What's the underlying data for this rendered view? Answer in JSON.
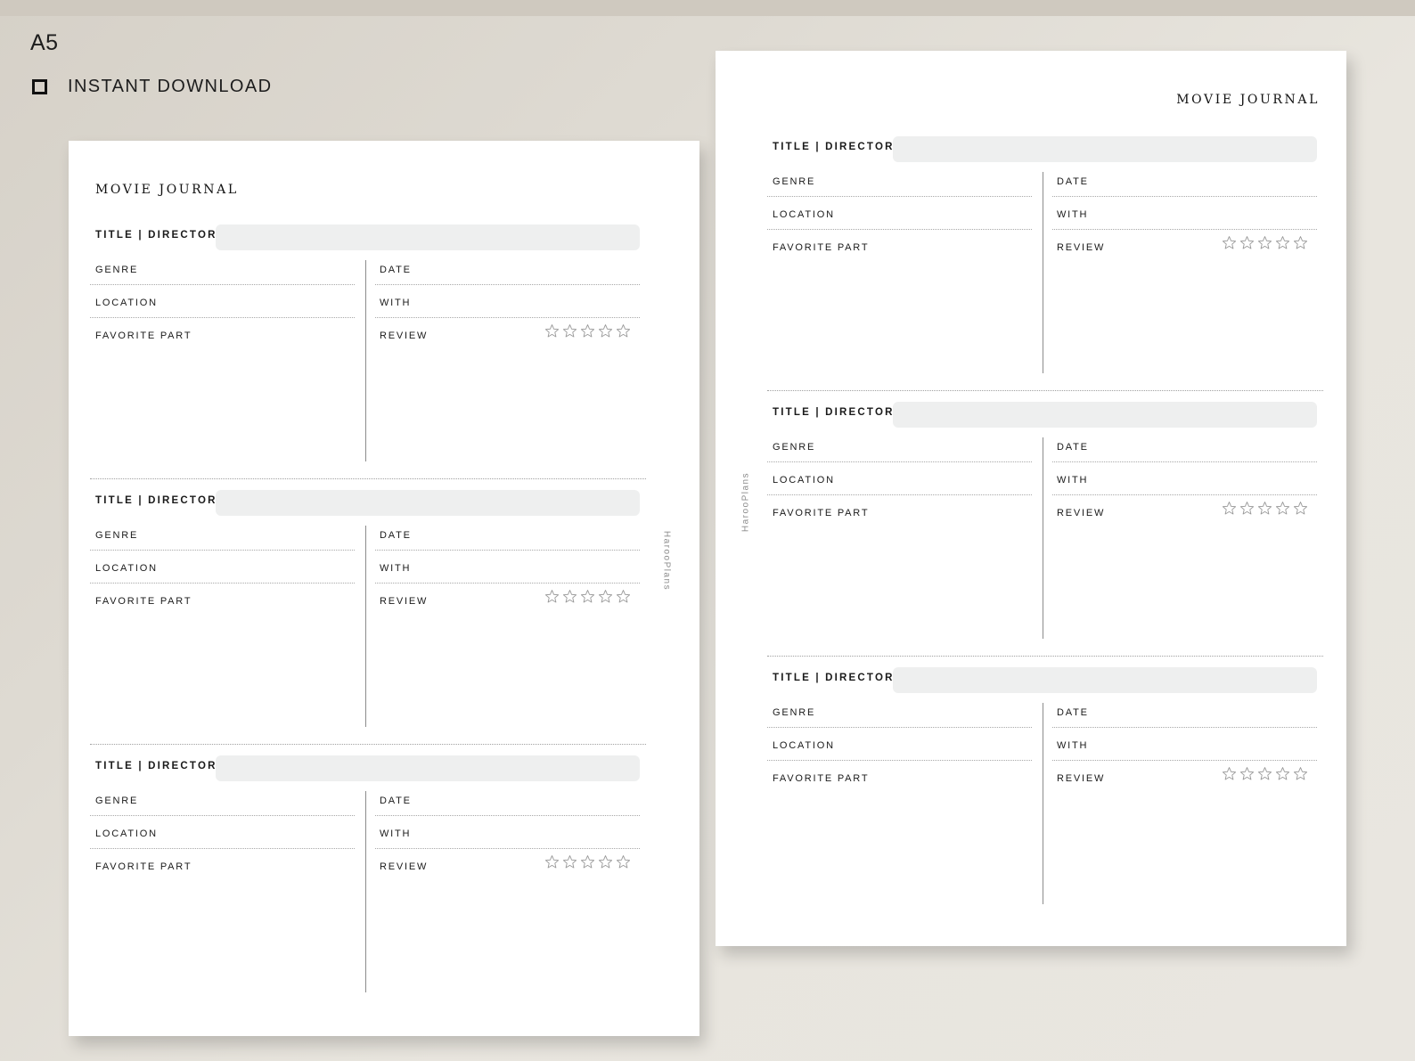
{
  "header": {
    "format_label": "A5",
    "download_label": "INSTANT DOWNLOAD"
  },
  "pages": [
    {
      "title": "MOVIE JOURNAL",
      "brand": "HarooPlans",
      "entries": [
        {
          "title_label": "TITLE | DIRECTOR",
          "genre": "GENRE",
          "location": "LOCATION",
          "favorite": "FAVORITE PART",
          "date": "DATE",
          "with": "WITH",
          "review": "REVIEW",
          "stars": 5
        },
        {
          "title_label": "TITLE | DIRECTOR",
          "genre": "GENRE",
          "location": "LOCATION",
          "favorite": "FAVORITE PART",
          "date": "DATE",
          "with": "WITH",
          "review": "REVIEW",
          "stars": 5
        },
        {
          "title_label": "TITLE | DIRECTOR",
          "genre": "GENRE",
          "location": "LOCATION",
          "favorite": "FAVORITE PART",
          "date": "DATE",
          "with": "WITH",
          "review": "REVIEW",
          "stars": 5
        }
      ]
    },
    {
      "title": "MOVIE JOURNAL",
      "brand": "HarooPlans",
      "entries": [
        {
          "title_label": "TITLE | DIRECTOR",
          "genre": "GENRE",
          "location": "LOCATION",
          "favorite": "FAVORITE PART",
          "date": "DATE",
          "with": "WITH",
          "review": "REVIEW",
          "stars": 5
        },
        {
          "title_label": "TITLE | DIRECTOR",
          "genre": "GENRE",
          "location": "LOCATION",
          "favorite": "FAVORITE PART",
          "date": "DATE",
          "with": "WITH",
          "review": "REVIEW",
          "stars": 5
        },
        {
          "title_label": "TITLE | DIRECTOR",
          "genre": "GENRE",
          "location": "LOCATION",
          "favorite": "FAVORITE PART",
          "date": "DATE",
          "with": "WITH",
          "review": "REVIEW",
          "stars": 5
        }
      ]
    }
  ],
  "icons": {
    "download_bullet": "square-outline-icon",
    "rating": "star-outline-icon"
  },
  "colors": {
    "background": "#e3dfd8",
    "paper": "#ffffff",
    "field_fill": "#eeefef",
    "star_stroke": "#9a9a9a",
    "brand_text": "#8b8b8b"
  }
}
